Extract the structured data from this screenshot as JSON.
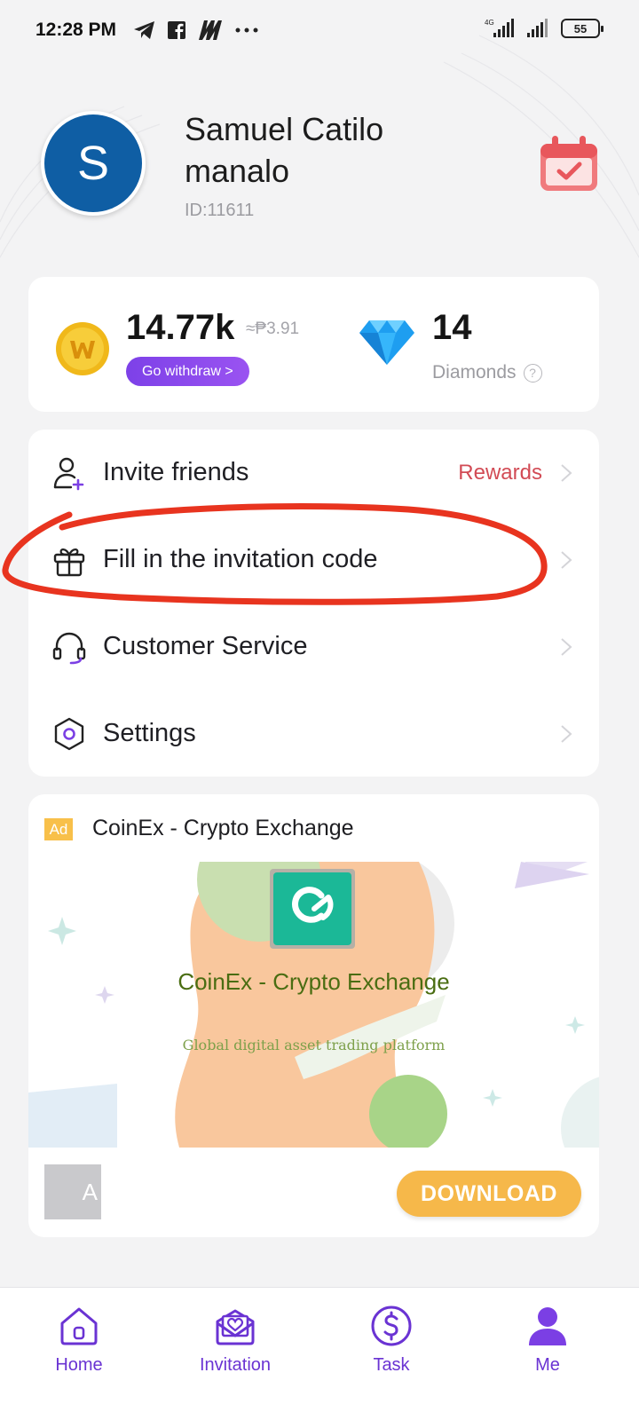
{
  "status_bar": {
    "time": "12:28 PM",
    "icons": [
      "telegram-icon",
      "facebook-icon",
      "app-notification-icon",
      "more-dots-icon"
    ],
    "network_label": "4G",
    "battery": "55"
  },
  "profile": {
    "avatar_letter": "S",
    "name": "Samuel Catilo manalo",
    "id": "ID:11611"
  },
  "balance": {
    "coins": "14.77k",
    "coins_approx": "≈₱3.91",
    "withdraw_label": "Go withdraw >",
    "diamonds": "14",
    "diamonds_label": "Diamonds"
  },
  "menu": {
    "items": [
      {
        "label": "Invite friends",
        "right": "Rewards",
        "icon": "add-user-icon"
      },
      {
        "label": "Fill in the invitation code",
        "right": "",
        "icon": "gift-icon"
      },
      {
        "label": "Customer Service",
        "right": "",
        "icon": "headset-icon"
      },
      {
        "label": "Settings",
        "right": "",
        "icon": "settings-icon"
      }
    ]
  },
  "ad": {
    "badge": "Ad",
    "title": "CoinEx - Crypto Exchange",
    "image_name": "CoinEx - Crypto Exchange",
    "image_tagline": "Global digital asset trading platform",
    "thumb_text": "A",
    "download_label": "DOWNLOAD"
  },
  "bottom_nav": {
    "items": [
      {
        "label": "Home",
        "icon": "home-icon"
      },
      {
        "label": "Invitation",
        "icon": "invitation-icon"
      },
      {
        "label": "Task",
        "icon": "dollar-icon"
      },
      {
        "label": "Me",
        "icon": "person-icon"
      }
    ]
  },
  "colors": {
    "accent": "#6a33d3",
    "rewards": "#d24b55",
    "annotation": "#e8341f",
    "download": "#f6b84a"
  }
}
